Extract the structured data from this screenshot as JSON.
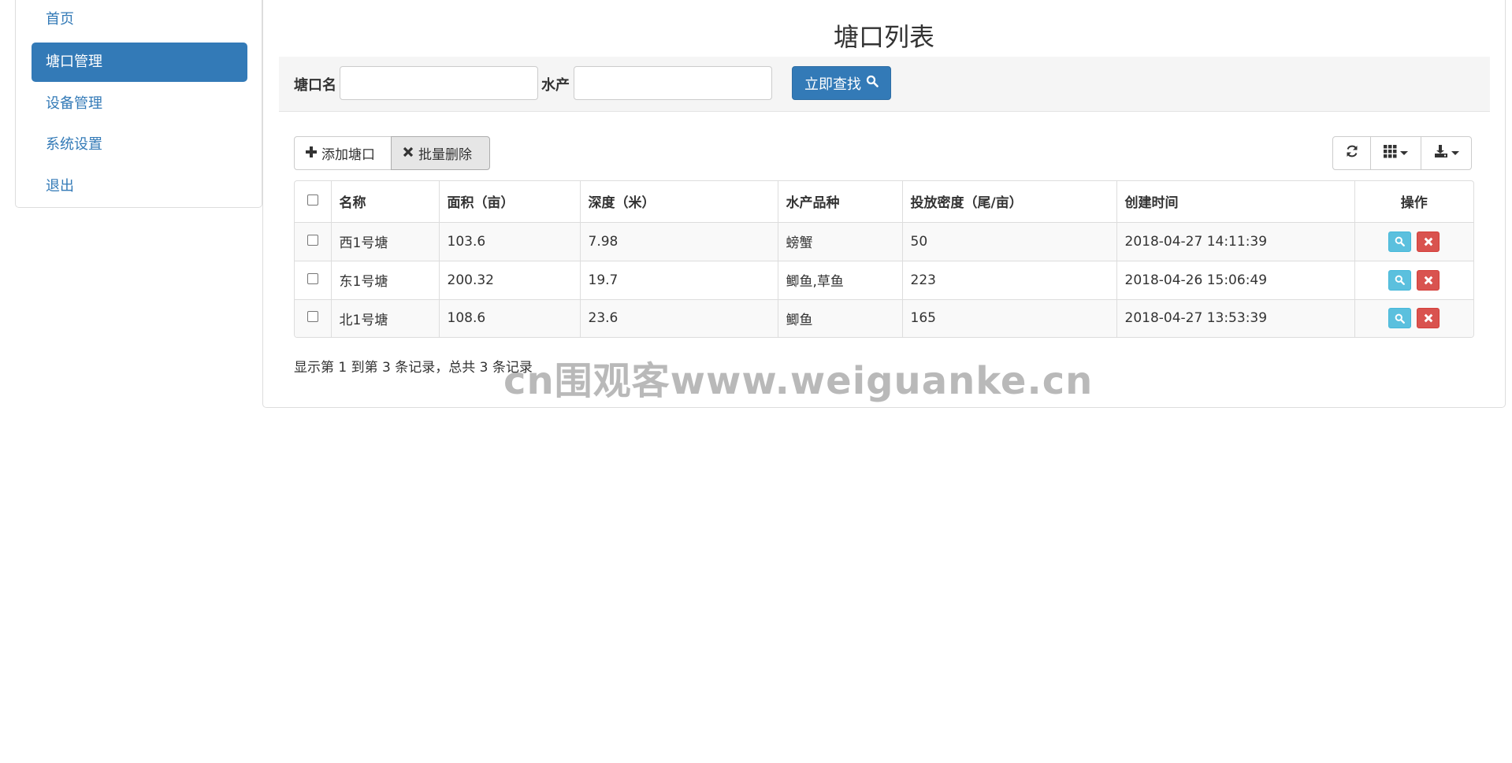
{
  "sidebar": {
    "items": [
      {
        "label": "首页"
      },
      {
        "label": "塘口管理"
      },
      {
        "label": "设备管理"
      },
      {
        "label": "系统设置"
      },
      {
        "label": "退出"
      }
    ],
    "active_index": 1
  },
  "page": {
    "title": "塘口列表"
  },
  "search": {
    "pond_label": "塘口名",
    "pond_value": "",
    "aquatic_label": "水产",
    "aquatic_value": "",
    "submit_label": "立即查找"
  },
  "toolbar": {
    "add_label": "添加塘口",
    "batch_delete_label": "批量删除",
    "refresh_icon": "refresh-icon",
    "columns_icon": "grid-icon",
    "export_icon": "export-icon"
  },
  "table": {
    "columns": [
      "名称",
      "面积（亩）",
      "深度（米）",
      "水产品种",
      "投放密度（尾/亩）",
      "创建时间",
      "操作"
    ],
    "rows": [
      {
        "name": "西1号塘",
        "area": "103.6",
        "depth": "7.98",
        "species": "螃蟹",
        "density": "50",
        "created": "2018-04-27 14:11:39"
      },
      {
        "name": "东1号塘",
        "area": "200.32",
        "depth": "19.7",
        "species": "鲫鱼,草鱼",
        "density": "223",
        "created": "2018-04-26 15:06:49"
      },
      {
        "name": "北1号塘",
        "area": "108.6",
        "depth": "23.6",
        "species": "鲫鱼",
        "density": "165",
        "created": "2018-04-27 13:53:39"
      }
    ]
  },
  "pagination": {
    "summary": "显示第 1 到第 3 条记录，总共 3 条记录"
  },
  "watermark": {
    "text": "cn围观客www.weiguanke.cn"
  },
  "colors": {
    "primary": "#337ab7",
    "info": "#5bc0de",
    "danger": "#d9534f",
    "search_bg": "#f5f5f5"
  }
}
